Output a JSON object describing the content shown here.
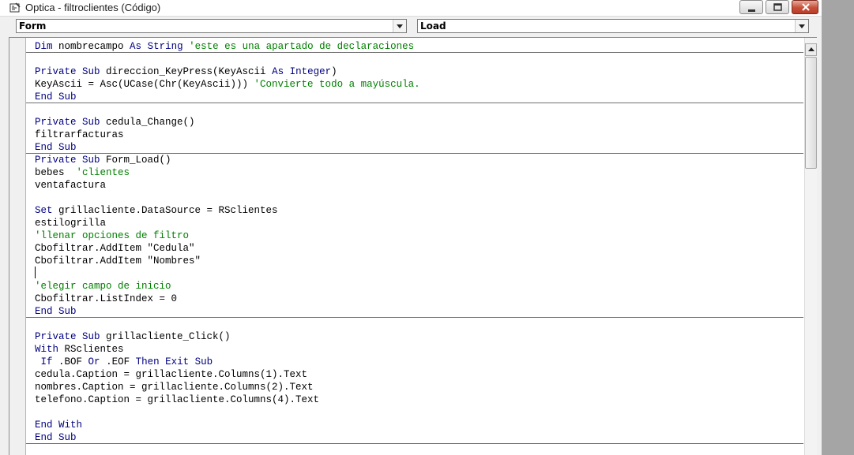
{
  "window": {
    "title": "Optica - filtroclientes (Código)",
    "icon": "vb-code-window-icon",
    "buttons": {
      "minimize": "minimize-icon",
      "maximize": "maximize-icon",
      "close": "close-icon"
    }
  },
  "toolbar": {
    "object_combo": {
      "value": "Form"
    },
    "procedure_combo": {
      "value": "Load"
    }
  },
  "code": {
    "lines": [
      {
        "kw": "Dim",
        "text": " nombrecampo ",
        "kw2": "As",
        "text2": " ",
        "kw3": "String",
        "text3": " ",
        "comment": "'este es una apartado de declaraciones"
      },
      {
        "text": ""
      },
      {
        "kw": "Private Sub",
        "text": " direccion_KeyPress(KeyAscii ",
        "kw2": "As",
        "text2": " ",
        "kw3": "Integer",
        "text3": ")"
      },
      {
        "text": "KeyAscii = Asc(UCase(Chr(KeyAscii))) ",
        "comment": "'Convierte todo a mayúscula."
      },
      {
        "kw": "End Sub"
      },
      {
        "text": ""
      },
      {
        "kw": "Private Sub",
        "text": " cedula_Change()"
      },
      {
        "text": "filtrarfacturas"
      },
      {
        "kw": "End Sub"
      },
      {
        "kw": "Private Sub",
        "text": " Form_Load()"
      },
      {
        "text": "bebes  ",
        "comment": "'clientes"
      },
      {
        "text": "ventafactura"
      },
      {
        "text": ""
      },
      {
        "kw": "Set",
        "text": " grillacliente.DataSource = RSclientes"
      },
      {
        "text": "estilogrilla"
      },
      {
        "comment": "'llenar opciones de filtro"
      },
      {
        "text": "Cbofiltrar.AddItem \"Cedula\""
      },
      {
        "text": "Cbofiltrar.AddItem \"Nombres\""
      },
      {
        "text": ""
      },
      {
        "comment": "'elegir campo de inicio"
      },
      {
        "text": "Cbofiltrar.ListIndex = 0"
      },
      {
        "kw": "End Sub"
      },
      {
        "text": ""
      },
      {
        "kw": "Private Sub",
        "text": " grillacliente_Click()"
      },
      {
        "kw": "With",
        "text": " RSclientes"
      },
      {
        "text": " ",
        "kw2": "If",
        "text2": " .BOF ",
        "kw3": "Or",
        "text3": " .EOF ",
        "kw4": "Then Exit Sub"
      },
      {
        "text": "cedula.Caption = grillacliente.Columns(1).Text"
      },
      {
        "text": "nombres.Caption = grillacliente.Columns(2).Text"
      },
      {
        "text": "telefono.Caption = grillacliente.Columns(4).Text"
      },
      {
        "text": ""
      },
      {
        "kw": "End With"
      },
      {
        "kw": "End Sub"
      }
    ]
  },
  "colors": {
    "keyword": "#000080",
    "comment": "#008000",
    "text": "#000000"
  }
}
